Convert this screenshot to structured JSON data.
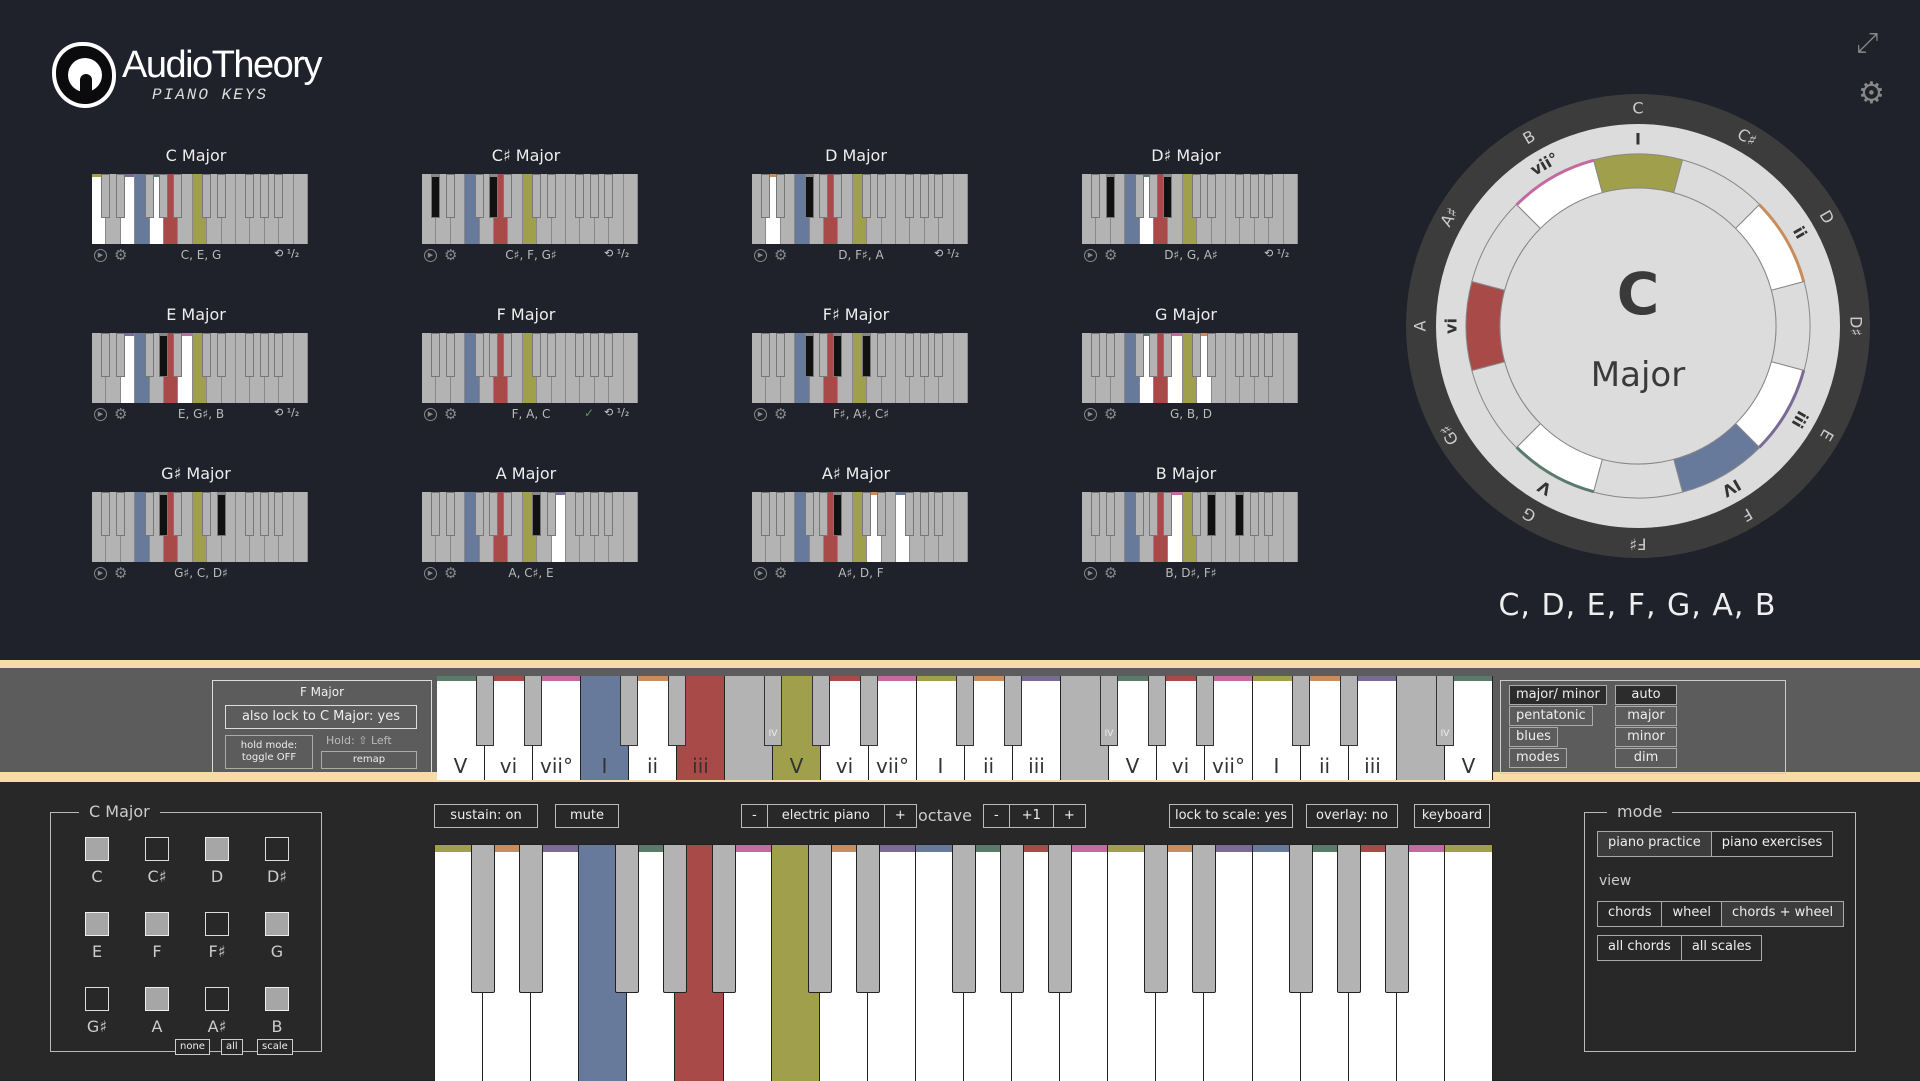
{
  "app": {
    "name": "AudioTheory",
    "subtitle": "PIANO KEYS"
  },
  "icons": {
    "fullscreen": "fullscreen-icon",
    "settings": "gear-icon"
  },
  "colors": {
    "I": "#a0a04c",
    "ii": "#c98c5c",
    "iii": "#7a6a96",
    "IV": "#687a9c",
    "V": "#5a7a6a",
    "vi": "#a84a48",
    "vii": "#c46aa0"
  },
  "chords": [
    {
      "title": "C Major",
      "notes": "C, E, G",
      "notes_idx": [
        0,
        4,
        7
      ],
      "check": false,
      "inversion": true
    },
    {
      "title": "C♯ Major",
      "notes": "C♯, F, G♯",
      "notes_idx": [
        1,
        5,
        8
      ],
      "check": false,
      "inversion": true
    },
    {
      "title": "D Major",
      "notes": "D, F♯, A",
      "notes_idx": [
        2,
        6,
        9
      ],
      "check": false,
      "inversion": true
    },
    {
      "title": "D♯ Major",
      "notes": "D♯, G, A♯",
      "notes_idx": [
        3,
        7,
        10
      ],
      "check": false,
      "inversion": true
    },
    {
      "title": "E Major",
      "notes": "E, G♯, B",
      "notes_idx": [
        4,
        8,
        11
      ],
      "check": false,
      "inversion": true
    },
    {
      "title": "F Major",
      "notes": "F, A, C",
      "notes_idx": [
        5,
        9,
        12
      ],
      "check": true,
      "inversion": true
    },
    {
      "title": "F♯ Major",
      "notes": "F♯, A♯, C♯",
      "notes_idx": [
        6,
        10,
        13
      ],
      "check": false,
      "inversion": false
    },
    {
      "title": "G Major",
      "notes": "G, B, D",
      "notes_idx": [
        7,
        11,
        14
      ],
      "check": false,
      "inversion": false
    },
    {
      "title": "G♯ Major",
      "notes": "G♯, C, D♯",
      "notes_idx": [
        8,
        12,
        15
      ],
      "check": false,
      "inversion": false
    },
    {
      "title": "A Major",
      "notes": "A, C♯, E",
      "notes_idx": [
        9,
        13,
        16
      ],
      "check": false,
      "inversion": false
    },
    {
      "title": "A♯ Major",
      "notes": "A♯, D, F",
      "notes_idx": [
        10,
        14,
        17
      ],
      "check": false,
      "inversion": false
    },
    {
      "title": "B Major",
      "notes": "B, D♯, F♯",
      "notes_idx": [
        11,
        15,
        18
      ],
      "check": false,
      "inversion": false
    }
  ],
  "chord_inversion_label": "¹/₂",
  "wheel": {
    "key": "C",
    "quality": "Major",
    "outer_notes": [
      "C",
      "C♯",
      "D",
      "D♯",
      "E",
      "F",
      "F♯",
      "G",
      "G♯",
      "A",
      "A♯",
      "B"
    ],
    "degrees": [
      {
        "note": 0,
        "label": "I"
      },
      {
        "note": 2,
        "label": "ii"
      },
      {
        "note": 4,
        "label": "iii"
      },
      {
        "note": 5,
        "label": "IV"
      },
      {
        "note": 7,
        "label": "V"
      },
      {
        "note": 9,
        "label": "vi"
      },
      {
        "note": 11,
        "label": "vii°"
      }
    ]
  },
  "scale_notes": "C, D, E, F, G, A, B",
  "lock_panel": {
    "chord": "F Major",
    "lock_label": "also lock to C Major: yes",
    "hold_mode": "hold mode: toggle OFF",
    "hold_key": "Hold: ⇧ Left",
    "remap": "remap"
  },
  "strip_keys": [
    "V",
    "vi",
    "vii°",
    "I",
    "ii",
    "iii",
    "IV",
    "V",
    "vi",
    "vii°",
    "I",
    "ii",
    "iii",
    "IV",
    "V",
    "vi",
    "vii°",
    "I",
    "ii",
    "iii",
    "IV",
    "V"
  ],
  "scale_types": [
    {
      "label": "major/ minor",
      "selected": true
    },
    {
      "label": "pentatonic",
      "selected": false
    },
    {
      "label": "blues",
      "selected": false
    },
    {
      "label": "modes",
      "selected": false
    }
  ],
  "chord_types": [
    {
      "label": "auto",
      "selected": true
    },
    {
      "label": "major",
      "selected": false
    },
    {
      "label": "minor",
      "selected": false
    },
    {
      "label": "dim",
      "selected": false
    }
  ],
  "note_select": {
    "title": "C Major",
    "notes": [
      {
        "n": "C",
        "on": true
      },
      {
        "n": "C♯",
        "on": false
      },
      {
        "n": "D",
        "on": true
      },
      {
        "n": "D♯",
        "on": false
      },
      {
        "n": "E",
        "on": true
      },
      {
        "n": "F",
        "on": true
      },
      {
        "n": "F♯",
        "on": false
      },
      {
        "n": "G",
        "on": true
      },
      {
        "n": "G♯",
        "on": false
      },
      {
        "n": "A",
        "on": true
      },
      {
        "n": "A♯",
        "on": false
      },
      {
        "n": "B",
        "on": true
      }
    ],
    "none": "none",
    "all": "all",
    "scale": "scale"
  },
  "controls": {
    "sustain": "sustain: on",
    "mute": "mute",
    "instrument_prev": "-",
    "instrument": "electric piano",
    "instrument_next": "+",
    "octave_label": "octave",
    "octave_down": "-",
    "octave_value": "+1",
    "octave_up": "+",
    "lock": "lock to scale: yes",
    "overlay": "overlay: no",
    "keyboard": "keyboard"
  },
  "mode_panel": {
    "title": "mode",
    "modes": [
      {
        "label": "piano practice",
        "selected": true
      },
      {
        "label": "piano exercises",
        "selected": false
      }
    ],
    "view_label": "view",
    "views": [
      {
        "label": "chords",
        "selected": false
      },
      {
        "label": "wheel",
        "selected": false
      },
      {
        "label": "chords + wheel",
        "selected": true
      }
    ],
    "lists": [
      {
        "label": "all chords",
        "selected": false
      },
      {
        "label": "all scales",
        "selected": false
      }
    ]
  }
}
